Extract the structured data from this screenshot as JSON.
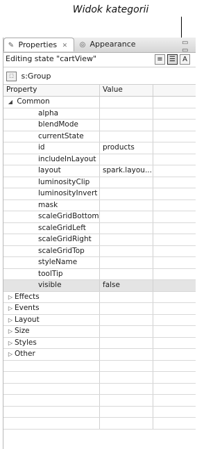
{
  "callout": {
    "text": "Widok kategorii"
  },
  "tabs": [
    {
      "label": "Properties",
      "icon": "properties-icon",
      "active": true
    },
    {
      "label": "Appearance",
      "icon": "appearance-icon",
      "active": false
    }
  ],
  "state_row": {
    "text": "Editing state \"cartView\""
  },
  "component": {
    "name": "s:Group"
  },
  "grid": {
    "headers": {
      "property": "Property",
      "value": "Value"
    },
    "category_expanded": "Common",
    "common_rows": [
      {
        "name": "alpha",
        "value": ""
      },
      {
        "name": "blendMode",
        "value": ""
      },
      {
        "name": "currentState",
        "value": ""
      },
      {
        "name": "id",
        "value": "products"
      },
      {
        "name": "includeInLayout",
        "value": ""
      },
      {
        "name": "layout",
        "value": "spark.layou..."
      },
      {
        "name": "luminosityClip",
        "value": ""
      },
      {
        "name": "luminosityInvert",
        "value": ""
      },
      {
        "name": "mask",
        "value": ""
      },
      {
        "name": "scaleGridBottom",
        "value": ""
      },
      {
        "name": "scaleGridLeft",
        "value": ""
      },
      {
        "name": "scaleGridRight",
        "value": ""
      },
      {
        "name": "scaleGridTop",
        "value": ""
      },
      {
        "name": "styleName",
        "value": ""
      },
      {
        "name": "toolTip",
        "value": ""
      },
      {
        "name": "visible",
        "value": "false",
        "selected": true
      }
    ],
    "collapsed_categories": [
      "Effects",
      "Events",
      "Layout",
      "Size",
      "Styles",
      "Other"
    ]
  }
}
